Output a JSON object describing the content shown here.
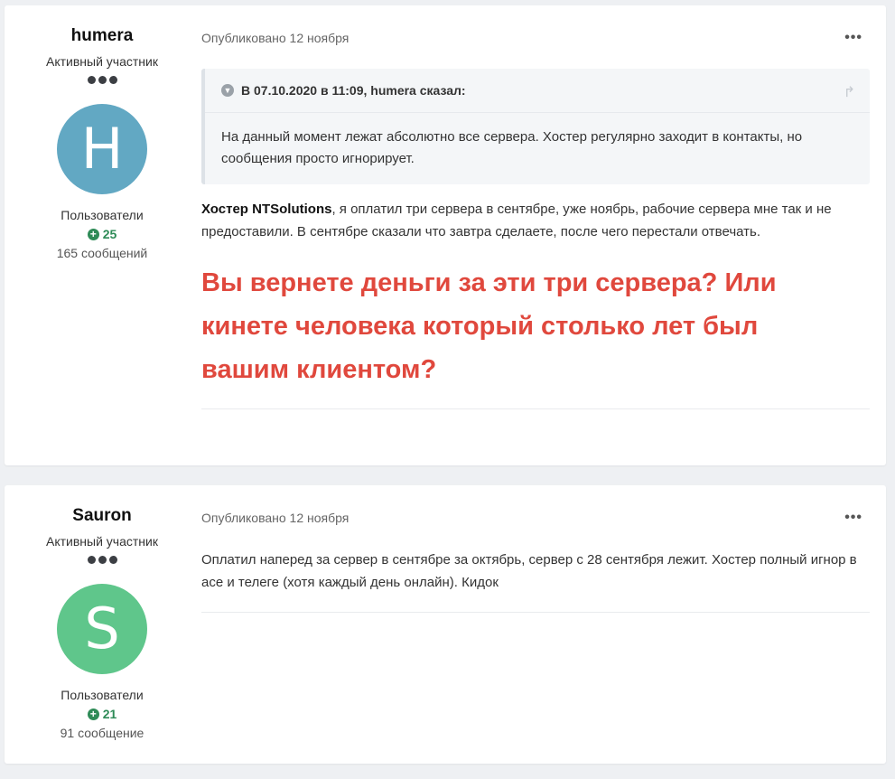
{
  "posts": [
    {
      "author": "humera",
      "rank": "Активный участник",
      "avatar_letter": "H",
      "avatar_color": "#62a8c3",
      "group": "Пользователи",
      "reputation": "25",
      "posts_count": "165 сообщений",
      "published": "Опубликовано 12 ноября",
      "quote": {
        "header": "В 07.10.2020 в 11:09, humera сказал:",
        "body": "На данный момент лежат абсолютно все сервера. Хостер регулярно заходит в контакты, но сообщения просто игнорирует."
      },
      "text_bold": "Хостер NTSolutions",
      "text_rest": ", я оплатил три сервера в сентябре, уже ноябрь, рабочие сервера мне так и не предоставили. В сентябре сказали что завтра сделаете, после чего перестали отвечать.",
      "big_text": "Вы вернете деньги за эти три сервера? Или кинете человека который столько лет был вашим клиентом?"
    },
    {
      "author": "Sauron",
      "rank": "Активный участник",
      "avatar_letter": "S",
      "avatar_color": "#5fc68b",
      "group": "Пользователи",
      "reputation": "21",
      "posts_count": "91 сообщение",
      "published": "Опубликовано 12 ноября",
      "text": "Оплатил наперед за сервер в сентябре за октябрь, сервер с 28 сентября лежит. Хостер полный игнор в асе и телеге (хотя каждый день онлайн). Кидок"
    }
  ],
  "icons": {
    "more": "•••",
    "rep_plus": "+",
    "quote_chevron": "▼",
    "share": "↱"
  }
}
